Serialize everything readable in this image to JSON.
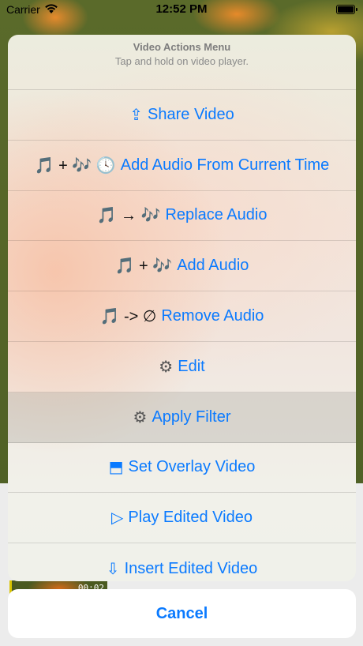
{
  "status_bar": {
    "carrier": "Carrier",
    "time": "12:52 PM"
  },
  "background": {
    "thumbnail_time": "00:02"
  },
  "sheet": {
    "title": "Video Actions Menu",
    "subtitle": "Tap and hold on video player.",
    "actions": [
      {
        "glyph": "⇪",
        "glyph_color": "#0a7aff",
        "label": "Share Video"
      },
      {
        "glyph": "🎵 + 🎶 🕓",
        "glyph_color": "#111111",
        "label": "Add Audio From Current Time"
      },
      {
        "glyph": "🎵 → 🎶",
        "glyph_color": "#111111",
        "label": "Replace Audio"
      },
      {
        "glyph": "🎵 + 🎶",
        "glyph_color": "#111111",
        "label": "Add Audio"
      },
      {
        "glyph": "🎵 -> ∅",
        "glyph_color": "#111111",
        "label": "Remove Audio"
      },
      {
        "glyph": "⚙",
        "glyph_color": "#555555",
        "label": "Edit"
      },
      {
        "glyph": "⚙",
        "glyph_color": "#555555",
        "label": "Apply Filter",
        "highlighted": true
      },
      {
        "glyph": "⬒",
        "glyph_color": "#0a7aff",
        "label": "Set Overlay Video"
      },
      {
        "glyph": "▷",
        "glyph_color": "#0a7aff",
        "label": "Play Edited Video"
      },
      {
        "glyph": "⇩",
        "glyph_color": "#0a7aff",
        "label": "Insert Edited Video"
      }
    ]
  },
  "cancel_label": "Cancel",
  "colors": {
    "accent": "#0a7aff"
  }
}
